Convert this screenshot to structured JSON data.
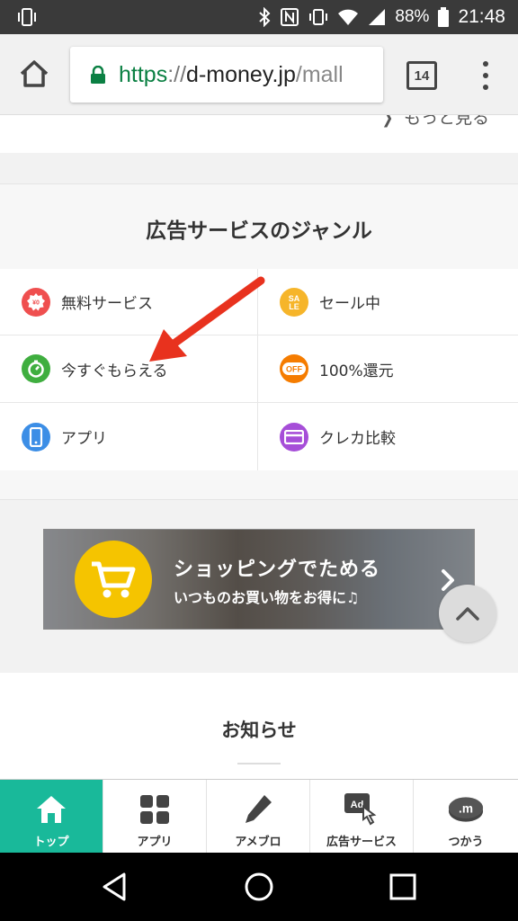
{
  "status_bar": {
    "battery": "88%",
    "time": "21:48"
  },
  "browser": {
    "url_scheme": "https",
    "url_sep": "://",
    "url_host": "d-money.jp",
    "url_path": "/mall",
    "tab_count": "14"
  },
  "prev_section": {
    "more_label": "もっと見る"
  },
  "genre": {
    "title": "広告サービスのジャンル",
    "items": [
      {
        "label": "無料サービス",
        "color": "#ef4f4f"
      },
      {
        "label": "セール中",
        "color": "#f6b52a"
      },
      {
        "label": "今すぐもらえる",
        "color": "#3fae3f"
      },
      {
        "label": "100%還元",
        "color": "#f57c00"
      },
      {
        "label": "アプリ",
        "color": "#3c8ee6"
      },
      {
        "label": "クレカ比較",
        "color": "#a64ed8"
      }
    ]
  },
  "banner": {
    "title": "ショッピングでためる",
    "subtitle": "いつものお買い物をお得に♫"
  },
  "news": {
    "title": "お知らせ"
  },
  "tabbar": {
    "accent": "#19b99a",
    "tabs": [
      {
        "label": "トップ",
        "icon": "home-icon",
        "active": true
      },
      {
        "label": "アプリ",
        "icon": "grid-icon",
        "active": false
      },
      {
        "label": "アメブロ",
        "icon": "pencil-icon",
        "active": false
      },
      {
        "label": "広告サービス",
        "icon": "ad-click-icon",
        "active": false
      },
      {
        "label": "つかう",
        "icon": "dmoney-coin-icon",
        "active": false
      }
    ]
  }
}
